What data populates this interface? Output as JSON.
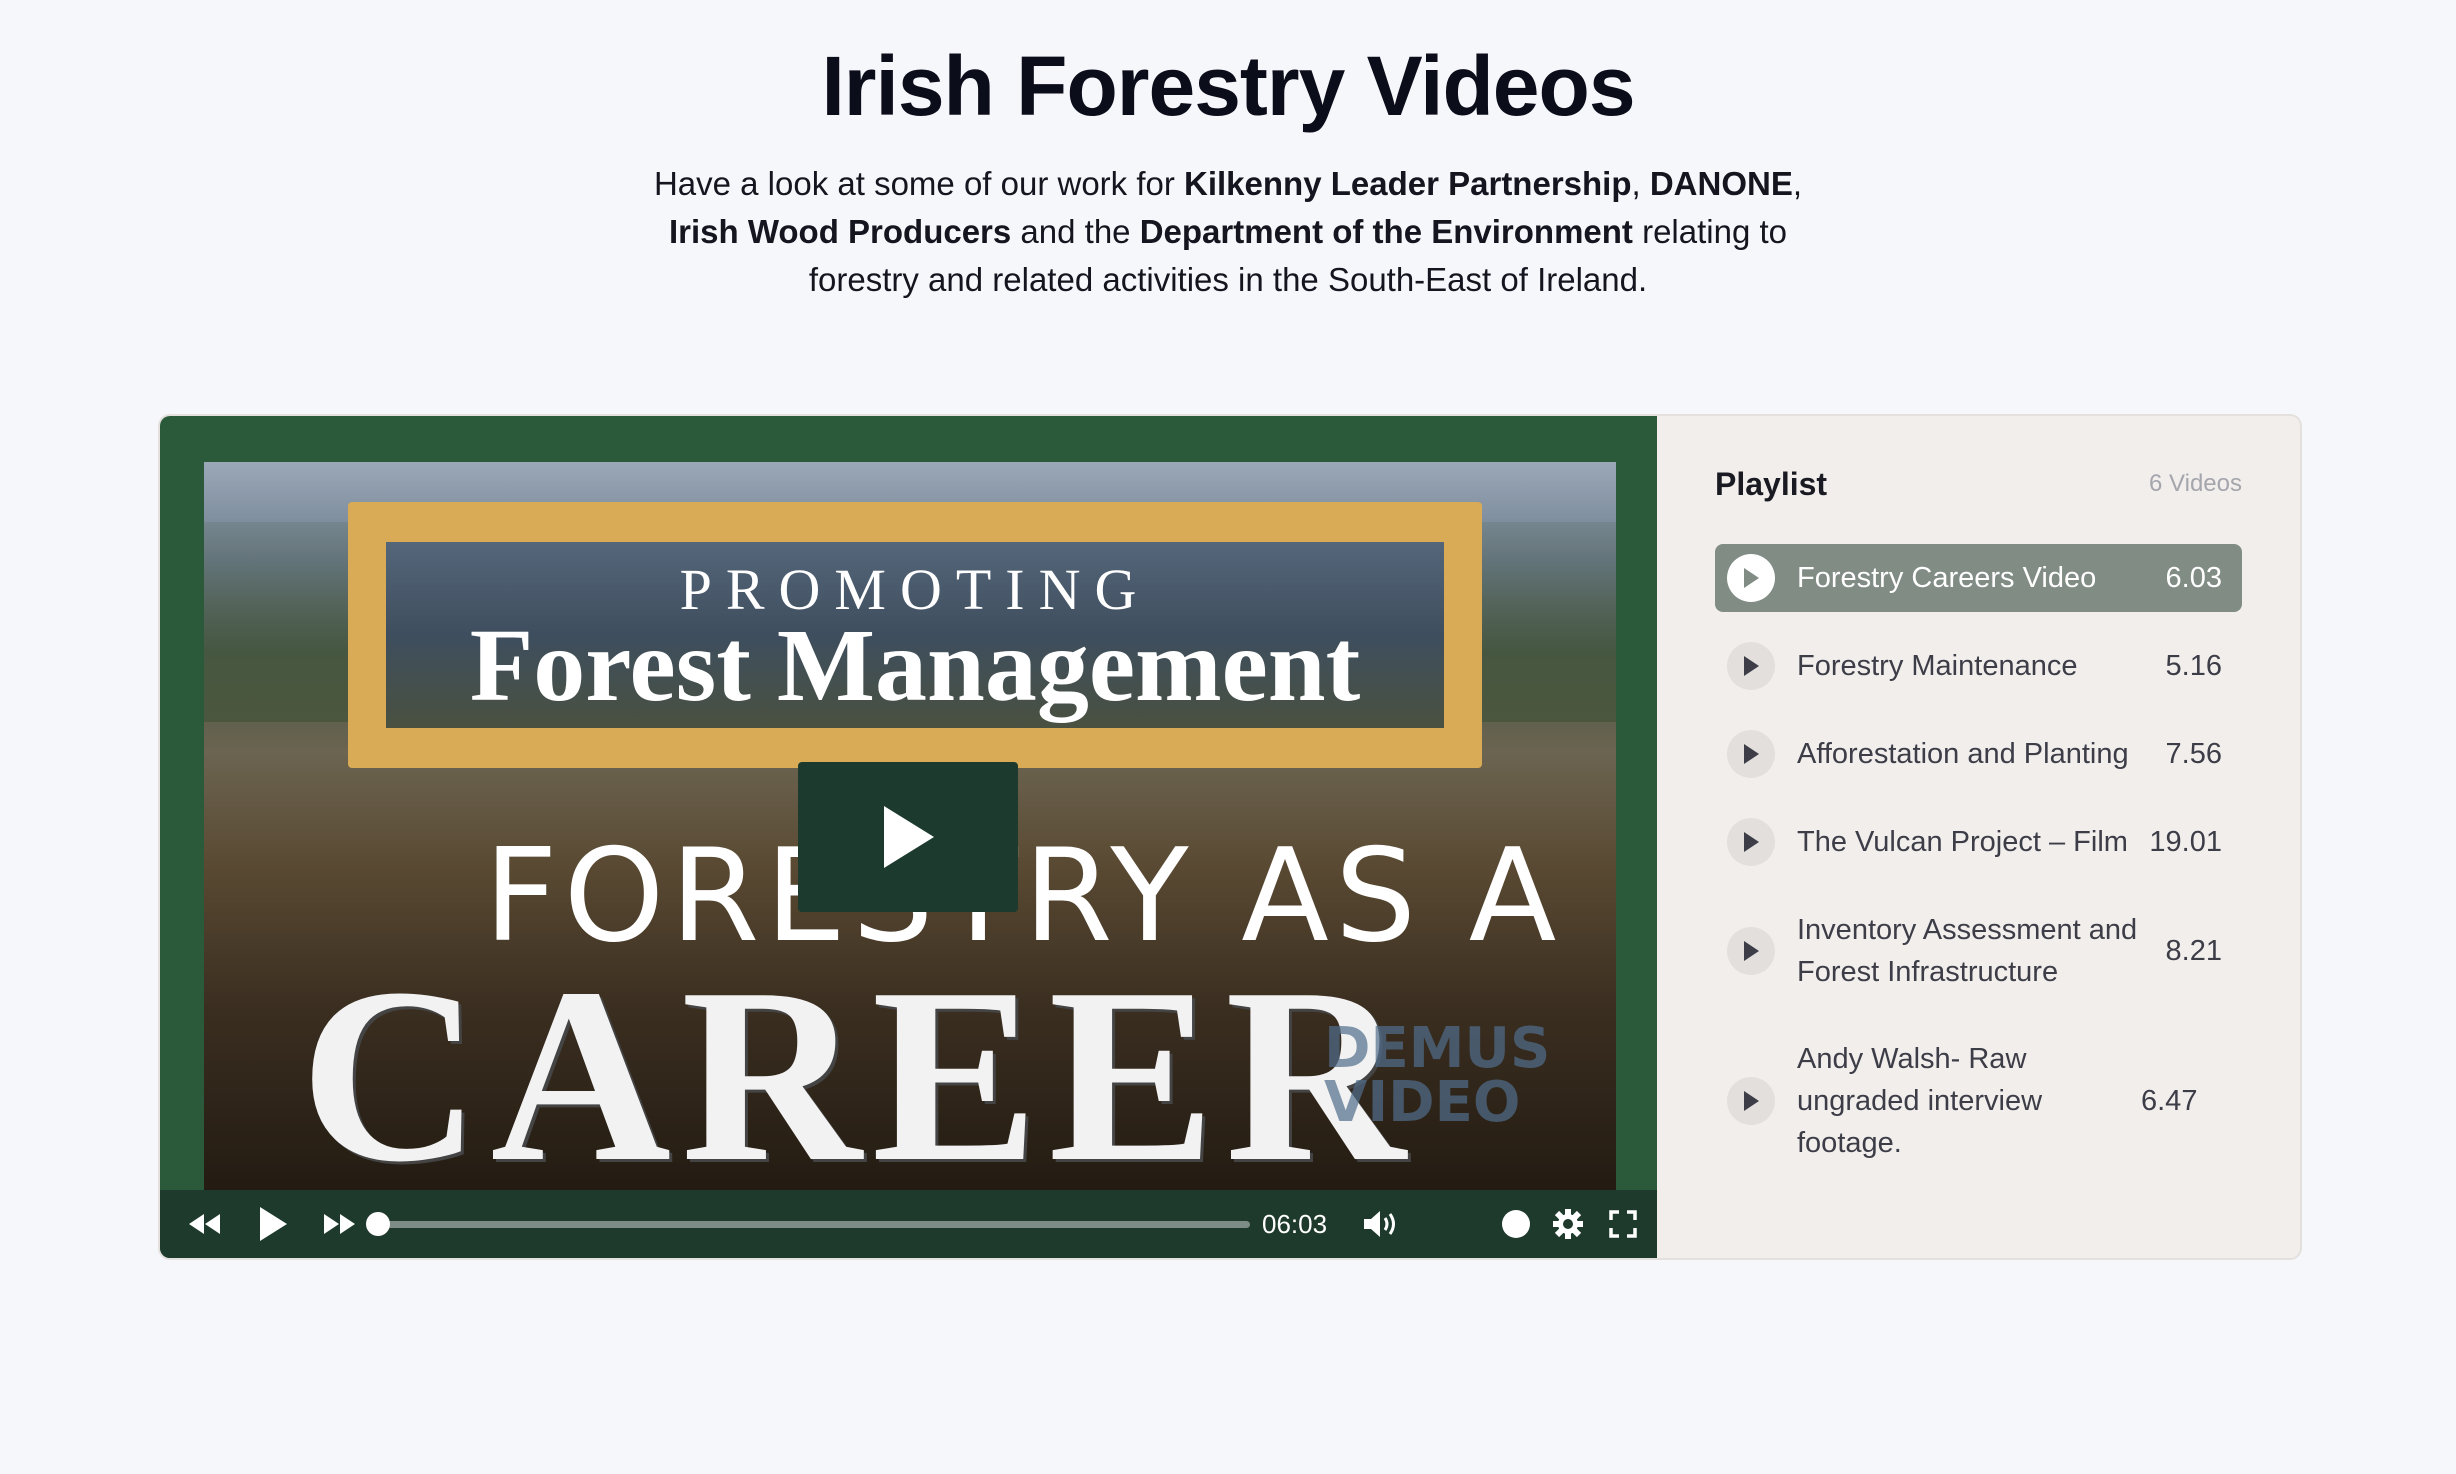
{
  "header": {
    "title": "Irish Forestry Videos",
    "intro_1": "Have a look at some of our work for ",
    "intro_b1": "Kilkenny Leader Partnership",
    "intro_2": ", ",
    "intro_b2": "DANONE",
    "intro_3": ",",
    "intro_b3": "Irish Wood Producers",
    "intro_4": " and the ",
    "intro_b4": "Department of the Environment",
    "intro_5": " relating to forestry and related activities in the South-East of Ireland."
  },
  "player": {
    "thumbnail": {
      "sign_sub": "PROMOTING",
      "sign_main": "Forest Management",
      "line1": "FORESTRY AS A",
      "line2": "CAREER",
      "watermark_1": "DEMUS",
      "watermark_2": "VIDEO"
    },
    "time": "06:03",
    "progress": 0,
    "icons": [
      "rewind-icon",
      "play-icon",
      "fast-forward-icon",
      "volume-icon",
      "settings-icon",
      "fullscreen-icon"
    ]
  },
  "playlist": {
    "title": "Playlist",
    "count": "6 Videos",
    "items": [
      {
        "name": "Forestry Careers Video",
        "duration": "6.03",
        "active": true
      },
      {
        "name": "Forestry Maintenance",
        "duration": "5.16"
      },
      {
        "name": "Afforestation and Planting",
        "duration": "7.56"
      },
      {
        "name": "The Vulcan Project – Film",
        "duration": "19.01"
      },
      {
        "name": "Inventory Assessment and Forest Infrastructure",
        "duration": "8.21"
      },
      {
        "name": "Andy Walsh- Raw ungraded interview footage.",
        "duration": "6.47"
      }
    ]
  },
  "colors": {
    "background": "#f6f7fb",
    "video_frame": "#2b5a3a",
    "controls": "#1e3a2c",
    "active_item": "#818c85",
    "playlist_bg": "#f1eeec"
  }
}
